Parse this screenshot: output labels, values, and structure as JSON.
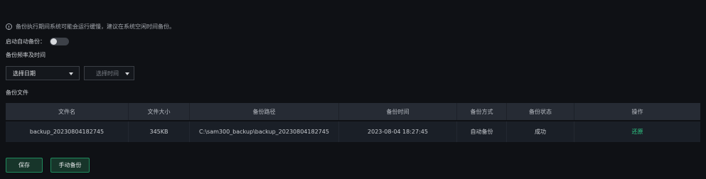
{
  "notice": {
    "text": "备份执行期间系统可能会运行缓慢，建议在系统空闲时间备份。"
  },
  "auto_backup": {
    "label": "启动自动备份：",
    "enabled": false
  },
  "frequency": {
    "label": "备份频率及时间",
    "date_select": {
      "value": "选择日期"
    },
    "time_select": {
      "value": "选择时间"
    }
  },
  "files": {
    "label": "备份文件",
    "columns": [
      "文件名",
      "文件大小",
      "备份路径",
      "备份时间",
      "备份方式",
      "备份状态",
      "操作"
    ],
    "rows": [
      {
        "name": "backup_20230804182745",
        "size": "345KB",
        "path": "C:\\sam300_backup\\backup_20230804182745",
        "time": "2023-08-04 18:27:45",
        "method": "自动备份",
        "status": "成功",
        "action": "还原"
      }
    ]
  },
  "buttons": {
    "save": "保存",
    "manual_backup": "手动备份"
  },
  "colors": {
    "background": "#0f1115",
    "accent_green": "#2fd08a",
    "button_border": "#1f8a5c",
    "header_bg": "#262b34",
    "row_bg": "#1a1f27"
  }
}
